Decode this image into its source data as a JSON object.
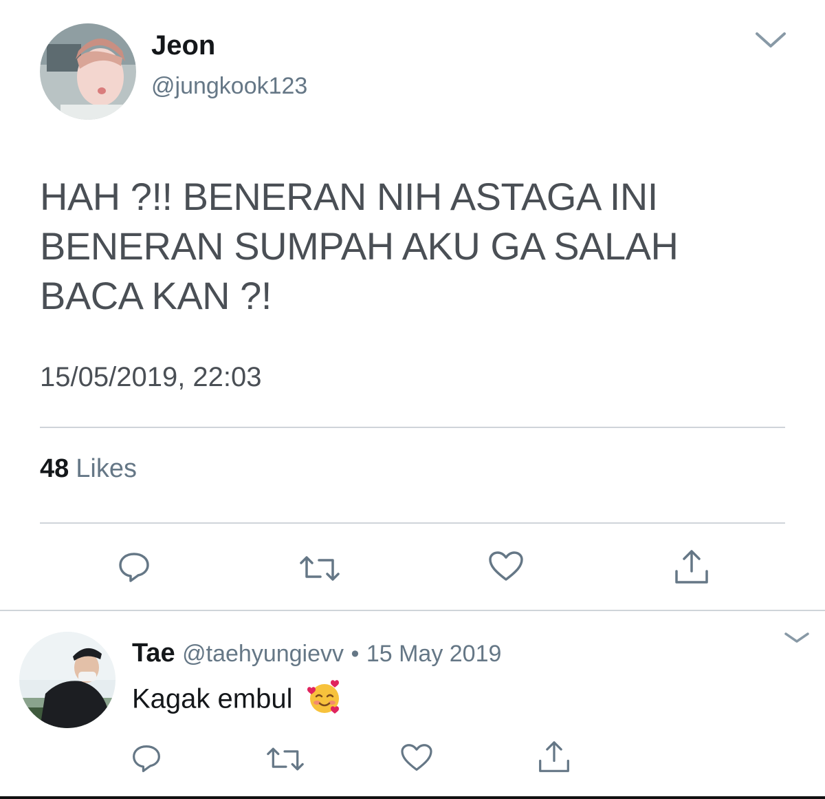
{
  "tweet": {
    "author_name": "Jeon",
    "author_handle": "@jungkook123",
    "text_line1": "HAH ?!! BENERAN NIH ASTAGA INI",
    "text_line2": "BENERAN SUMPAH AKU GA SALAH",
    "text_line3": "BACA KAN ?!",
    "timestamp": "15/05/2019, 22:03",
    "likes_count": "48",
    "likes_label": "Likes"
  },
  "reply": {
    "author_name": "Tae",
    "author_handle": "@taehyungievv",
    "separator": "•",
    "date": "15 May 2019",
    "text": "Kagak embul",
    "emoji": "🥰"
  },
  "colors": {
    "icon_gray": "#657786",
    "divider": "#cfd4d9",
    "text_dark": "#14171a"
  },
  "icons": [
    "chevron-down-icon",
    "reply-icon",
    "retweet-icon",
    "like-icon",
    "share-icon",
    "emoji-smiling-hearts"
  ]
}
